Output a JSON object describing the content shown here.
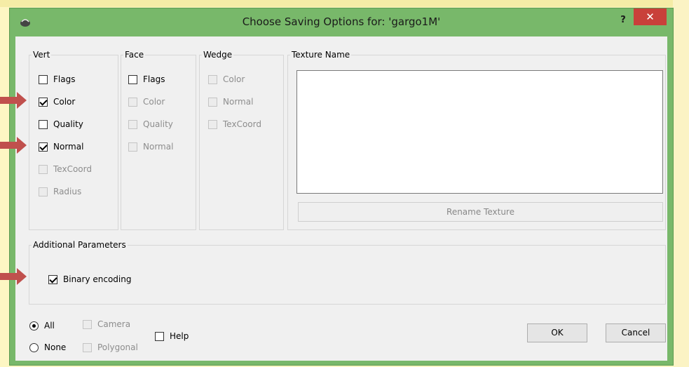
{
  "window": {
    "title": "Choose Saving Options for: 'gargo1M'",
    "help_label": "?",
    "close_label": "✕"
  },
  "vert": {
    "title": "Vert",
    "items": [
      {
        "label": "Flags",
        "checked": false,
        "enabled": true
      },
      {
        "label": "Color",
        "checked": true,
        "enabled": true
      },
      {
        "label": "Quality",
        "checked": false,
        "enabled": true
      },
      {
        "label": "Normal",
        "checked": true,
        "enabled": true
      },
      {
        "label": "TexCoord",
        "checked": false,
        "enabled": false
      },
      {
        "label": "Radius",
        "checked": false,
        "enabled": false
      }
    ]
  },
  "face": {
    "title": "Face",
    "items": [
      {
        "label": "Flags",
        "checked": false,
        "enabled": true
      },
      {
        "label": "Color",
        "checked": false,
        "enabled": false
      },
      {
        "label": "Quality",
        "checked": false,
        "enabled": false
      },
      {
        "label": "Normal",
        "checked": false,
        "enabled": false
      }
    ]
  },
  "wedge": {
    "title": "Wedge",
    "items": [
      {
        "label": "Color",
        "checked": false,
        "enabled": false
      },
      {
        "label": "Normal",
        "checked": false,
        "enabled": false
      },
      {
        "label": "TexCoord",
        "checked": false,
        "enabled": false
      }
    ]
  },
  "texture": {
    "title": "Texture Name",
    "rename_label": "Rename Texture"
  },
  "additional": {
    "title": "Additional Parameters",
    "binary_label": "Binary encoding",
    "binary_checked": true
  },
  "bottom": {
    "all_label": "All",
    "none_label": "None",
    "camera_label": "Camera",
    "polygonal_label": "Polygonal",
    "help_label": "Help",
    "ok_label": "OK",
    "cancel_label": "Cancel"
  },
  "colors": {
    "window_frame": "#78b86a",
    "close_button": "#c9403a",
    "annotation_arrow": "#c0504d"
  }
}
